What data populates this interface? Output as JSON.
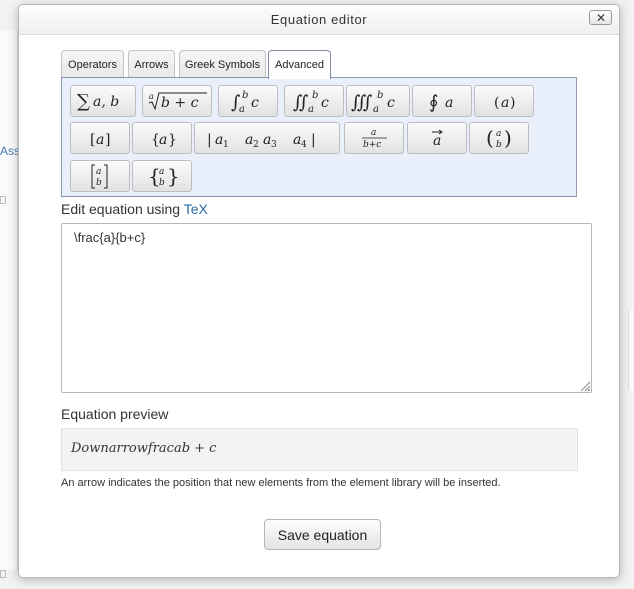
{
  "dialog": {
    "title": "Equation editor",
    "close_label": "✕"
  },
  "tabs": [
    {
      "label": "Operators",
      "active": false
    },
    {
      "label": "Arrows",
      "active": false
    },
    {
      "label": "Greek Symbols",
      "active": false
    },
    {
      "label": "Advanced",
      "active": true
    }
  ],
  "palette": {
    "buttons": [
      {
        "name": "sum-button",
        "label": "Σ a, b"
      },
      {
        "name": "nth-root-button",
        "label": "ⁿ√(b + c)"
      },
      {
        "name": "integral-button",
        "label": "∫ₐᵇ c"
      },
      {
        "name": "double-integral-button",
        "label": "∬ₐᵇ c"
      },
      {
        "name": "triple-integral-button",
        "label": "∭ₐᵇ c"
      },
      {
        "name": "contour-integral-button",
        "label": "∮ a"
      },
      {
        "name": "parentheses-button",
        "label": "(a)"
      },
      {
        "name": "square-brackets-button",
        "label": "[a]"
      },
      {
        "name": "curly-braces-button",
        "label": "{a}"
      },
      {
        "name": "matrix-button",
        "label": "| a₁  a₂ a₃  a₄ |"
      },
      {
        "name": "fraction-button",
        "label": "a / b+c"
      },
      {
        "name": "vector-button",
        "label": "a⃗"
      },
      {
        "name": "binomial-button",
        "label": "(a b)"
      },
      {
        "name": "bracket-matrix-button",
        "label": "[a b]"
      },
      {
        "name": "brace-matrix-button",
        "label": "{a b}"
      }
    ]
  },
  "editor": {
    "label_prefix": "Edit equation using ",
    "label_link": "TeX",
    "value": "\\frac{a}{b+c}"
  },
  "preview": {
    "label": "Equation preview",
    "content": "Downarrowfracab + c",
    "hint": "An arrow indicates the position that new elements from the element library will be inserted."
  },
  "footer": {
    "save_label": "Save equation"
  },
  "background": {
    "fragment_text": "Ass"
  },
  "colors": {
    "palette_bg": "#e9f0fb",
    "link": "#2a6aa5",
    "preview_bg": "#f3f3f3"
  }
}
